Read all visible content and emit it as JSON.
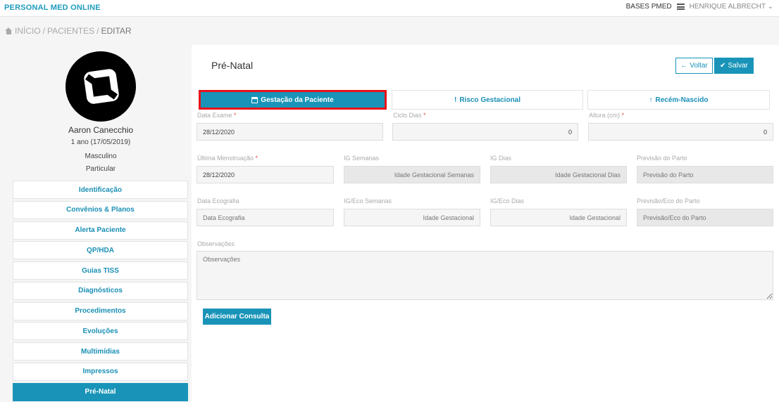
{
  "header": {
    "brand": "PERSONAL MED ONLINE",
    "base": "BASES PMED",
    "menu_icon": "bars-icon",
    "user": "HENRIQUE ALBRECHT",
    "user_caret": "⌄"
  },
  "breadcrumb": {
    "icon": "home-icon",
    "items": [
      "INÍCIO",
      "PACIENTES",
      "EDITAR"
    ],
    "sep": "/"
  },
  "patient": {
    "name": "Aaron Canecchio",
    "age": "1 ano (17/05/2019)",
    "sex": "Masculino",
    "plan": "Particular"
  },
  "menu": [
    "Identificação",
    "Convênios & Planos",
    "Alerta Paciente",
    "QP/HDA",
    "Guias TISS",
    "Diagnósticos",
    "Procedimentos",
    "Evoluções",
    "Multimídias",
    "Impressos",
    "Pré-Natal"
  ],
  "menu_active": "Pré-Natal",
  "page": {
    "title": "Pré-Natal",
    "voltar": "Voltar",
    "salvar": "Salvar"
  },
  "tabs": {
    "gestacao": "Gestação da Paciente",
    "risco": "Risco Gestacional",
    "recem": "Recém-Nascido"
  },
  "form": {
    "data_exame": {
      "label": "Data Exame",
      "req": "*",
      "value": "28/12/2020"
    },
    "ciclo_dias": {
      "label": "Ciclo Dias",
      "req": "*",
      "value": "0"
    },
    "altura": {
      "label": "Altura (cm)",
      "req": "*",
      "value": "0"
    },
    "ultima_menstruacao": {
      "label": "Última Menstruação",
      "req": "*",
      "value": "28/12/2020"
    },
    "ig_semanas": {
      "label": "IG Semanas",
      "placeholder": "Idade Gestacional Semanas"
    },
    "ig_dias": {
      "label": "IG Dias",
      "placeholder": "Idade Gestacional Dias"
    },
    "previsao_parto": {
      "label": "Previsão do Parto",
      "placeholder": "Previsão do Parto"
    },
    "data_ecografia": {
      "label": "Data Ecografia",
      "placeholder": "Data Ecografia"
    },
    "ig_eco_semanas": {
      "label": "IG/Eco Semanas",
      "placeholder": "Idade Gestacional"
    },
    "ig_eco_dias": {
      "label": "IG/Eco Dias",
      "placeholder": "Idade Gestacional"
    },
    "previsao_eco_parto": {
      "label": "Previsão/Eco do Parto",
      "placeholder": "Previsão/Eco do Parto"
    },
    "observacoes": {
      "label": "Observações",
      "placeholder": "Observações"
    }
  },
  "add_button": "Adicionar Consulta",
  "colors": {
    "accent": "#1994b8",
    "highlight": "#e8101a"
  }
}
